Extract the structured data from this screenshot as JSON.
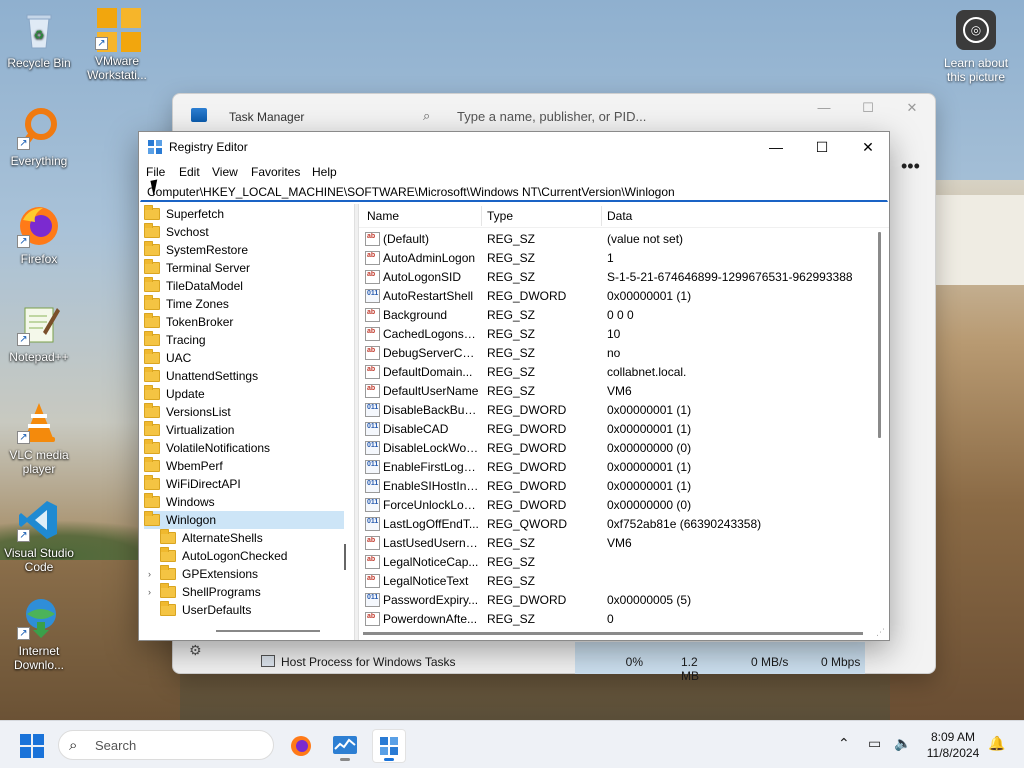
{
  "desktop": {
    "icons": [
      {
        "label": "Recycle Bin",
        "icon": "recycle-bin-icon"
      },
      {
        "label": "VMware Workstati...",
        "icon": "vmware-icon"
      },
      {
        "label": "Everything",
        "icon": "everything-search-icon"
      },
      {
        "label": "Firefox",
        "icon": "firefox-icon"
      },
      {
        "label": "Notepad++",
        "icon": "notepadpp-icon"
      },
      {
        "label": "VLC media player",
        "icon": "vlc-icon"
      },
      {
        "label": "Visual Studio Code",
        "icon": "vscode-icon"
      },
      {
        "label": "Internet Downlo...",
        "icon": "idm-icon"
      }
    ],
    "learn": "Learn about this picture"
  },
  "task_manager": {
    "title": "Task Manager",
    "search_placeholder": "Type a name, publisher, or PID...",
    "row": {
      "name": "Host Process for Windows Tasks",
      "cpu": "0%",
      "memory": "1.2 MB",
      "disk": "0 MB/s",
      "network": "0 Mbps"
    }
  },
  "registry": {
    "title": "Registry Editor",
    "menu": [
      "File",
      "Edit",
      "View",
      "Favorites",
      "Help"
    ],
    "address": "Computer\\HKEY_LOCAL_MACHINE\\SOFTWARE\\Microsoft\\Windows NT\\CurrentVersion\\Winlogon",
    "tree": [
      {
        "label": "Superfetch",
        "level": 0
      },
      {
        "label": "Svchost",
        "level": 0
      },
      {
        "label": "SystemRestore",
        "level": 0
      },
      {
        "label": "Terminal Server",
        "level": 0
      },
      {
        "label": "TileDataModel",
        "level": 0
      },
      {
        "label": "Time Zones",
        "level": 0
      },
      {
        "label": "TokenBroker",
        "level": 0
      },
      {
        "label": "Tracing",
        "level": 0
      },
      {
        "label": "UAC",
        "level": 0
      },
      {
        "label": "UnattendSettings",
        "level": 0
      },
      {
        "label": "Update",
        "level": 0
      },
      {
        "label": "VersionsList",
        "level": 0
      },
      {
        "label": "Virtualization",
        "level": 0
      },
      {
        "label": "VolatileNotifications",
        "level": 0
      },
      {
        "label": "WbemPerf",
        "level": 0
      },
      {
        "label": "WiFiDirectAPI",
        "level": 0
      },
      {
        "label": "Windows",
        "level": 0
      },
      {
        "label": "Winlogon",
        "level": 0,
        "selected": true
      },
      {
        "label": "AlternateShells",
        "level": 1
      },
      {
        "label": "AutoLogonChecked",
        "level": 1
      },
      {
        "label": "GPExtensions",
        "level": 1,
        "expandable": true
      },
      {
        "label": "ShellPrograms",
        "level": 1,
        "expandable": true
      },
      {
        "label": "UserDefaults",
        "level": 1
      }
    ],
    "columns": {
      "name": "Name",
      "type": "Type",
      "data": "Data"
    },
    "values": [
      {
        "name": "(Default)",
        "type": "REG_SZ",
        "data": "(value not set)",
        "kind": "sz"
      },
      {
        "name": "AutoAdminLogon",
        "type": "REG_SZ",
        "data": "1",
        "kind": "sz"
      },
      {
        "name": "AutoLogonSID",
        "type": "REG_SZ",
        "data": "S-1-5-21-674646899-1299676531-962993388",
        "kind": "sz"
      },
      {
        "name": "AutoRestartShell",
        "type": "REG_DWORD",
        "data": "0x00000001 (1)",
        "kind": "dw"
      },
      {
        "name": "Background",
        "type": "REG_SZ",
        "data": "0 0 0",
        "kind": "sz"
      },
      {
        "name": "CachedLogonsC...",
        "type": "REG_SZ",
        "data": "10",
        "kind": "sz"
      },
      {
        "name": "DebugServerCo...",
        "type": "REG_SZ",
        "data": "no",
        "kind": "sz"
      },
      {
        "name": "DefaultDomain...",
        "type": "REG_SZ",
        "data": "collabnet.local.",
        "kind": "sz"
      },
      {
        "name": "DefaultUserName",
        "type": "REG_SZ",
        "data": "VM6",
        "kind": "sz"
      },
      {
        "name": "DisableBackButt...",
        "type": "REG_DWORD",
        "data": "0x00000001 (1)",
        "kind": "dw"
      },
      {
        "name": "DisableCAD",
        "type": "REG_DWORD",
        "data": "0x00000001 (1)",
        "kind": "dw"
      },
      {
        "name": "DisableLockWor...",
        "type": "REG_DWORD",
        "data": "0x00000000 (0)",
        "kind": "dw"
      },
      {
        "name": "EnableFirstLogo...",
        "type": "REG_DWORD",
        "data": "0x00000001 (1)",
        "kind": "dw"
      },
      {
        "name": "EnableSIHostInt...",
        "type": "REG_DWORD",
        "data": "0x00000001 (1)",
        "kind": "dw"
      },
      {
        "name": "ForceUnlockLog...",
        "type": "REG_DWORD",
        "data": "0x00000000 (0)",
        "kind": "dw"
      },
      {
        "name": "LastLogOffEndT...",
        "type": "REG_QWORD",
        "data": "0xf752ab81e (66390243358)",
        "kind": "dw"
      },
      {
        "name": "LastUsedUserna...",
        "type": "REG_SZ",
        "data": "VM6",
        "kind": "sz"
      },
      {
        "name": "LegalNoticeCap...",
        "type": "REG_SZ",
        "data": "",
        "kind": "sz"
      },
      {
        "name": "LegalNoticeText",
        "type": "REG_SZ",
        "data": "",
        "kind": "sz"
      },
      {
        "name": "PasswordExpiry...",
        "type": "REG_DWORD",
        "data": "0x00000005 (5)",
        "kind": "dw"
      },
      {
        "name": "PowerdownAfte...",
        "type": "REG_SZ",
        "data": "0",
        "kind": "sz"
      }
    ]
  },
  "taskbar": {
    "search_placeholder": "Search",
    "time": "8:09 AM",
    "date": "11/8/2024",
    "apps": [
      "firefox-icon",
      "task-manager-icon",
      "registry-editor-icon"
    ]
  },
  "colors": {
    "accent": "#1a63c5",
    "selection": "#cde5f7",
    "folder": "#f4c443"
  }
}
